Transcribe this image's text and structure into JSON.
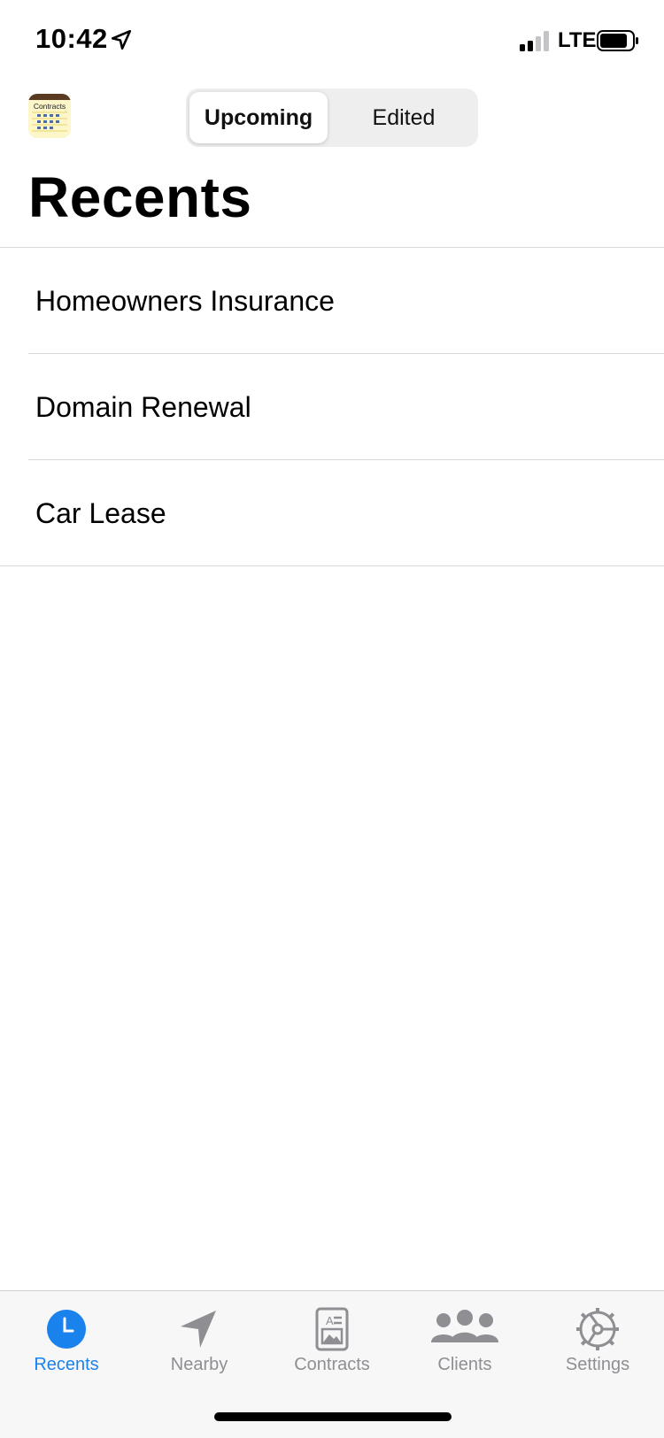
{
  "status_bar": {
    "time": "10:42",
    "network": "LTE",
    "location_icon": "location-arrow-icon",
    "signal_icon": "cellular-signal-icon",
    "battery_icon": "battery-icon"
  },
  "header": {
    "app_icon": "contracts-app-icon",
    "app_icon_text": "Contracts",
    "segments": [
      {
        "label": "Upcoming",
        "selected": true
      },
      {
        "label": "Edited",
        "selected": false
      }
    ],
    "title": "Recents"
  },
  "list": {
    "items": [
      {
        "label": "Homeowners Insurance"
      },
      {
        "label": "Domain Renewal"
      },
      {
        "label": "Car Lease"
      }
    ]
  },
  "tab_bar": {
    "tabs": [
      {
        "label": "Recents",
        "icon": "clock-icon",
        "active": true
      },
      {
        "label": "Nearby",
        "icon": "location-arrow-icon",
        "active": false
      },
      {
        "label": "Contracts",
        "icon": "contract-document-icon",
        "active": false
      },
      {
        "label": "Clients",
        "icon": "people-icon",
        "active": false
      },
      {
        "label": "Settings",
        "icon": "gear-icon",
        "active": false
      }
    ]
  },
  "colors": {
    "accent": "#1a82ed",
    "inactive_tab": "#8e8e93",
    "separator": "#d8d8dc",
    "segment_bg": "#eeeeef"
  }
}
